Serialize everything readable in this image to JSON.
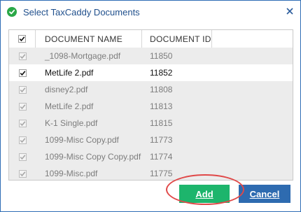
{
  "window": {
    "title": "Select TaxCaddy Documents",
    "close_glyph": "×",
    "icon": "taxcaddy-check-icon"
  },
  "table": {
    "columns": [
      "DOCUMENT NAME",
      "DOCUMENT ID"
    ],
    "header_checked": true,
    "rows": [
      {
        "name": "_1098-Mortgage.pdf",
        "id": "11850",
        "checked": true,
        "disabled": true
      },
      {
        "name": "MetLife 2.pdf",
        "id": "11852",
        "checked": true,
        "disabled": false
      },
      {
        "name": "disney2.pdf",
        "id": "11808",
        "checked": true,
        "disabled": true
      },
      {
        "name": "MetLife 2.pdf",
        "id": "11813",
        "checked": true,
        "disabled": true
      },
      {
        "name": "K-1 Single.pdf",
        "id": "11815",
        "checked": true,
        "disabled": true
      },
      {
        "name": "1099-Misc Copy.pdf",
        "id": "11773",
        "checked": true,
        "disabled": true
      },
      {
        "name": "1099-Misc Copy Copy.pdf",
        "id": "11774",
        "checked": true,
        "disabled": true
      },
      {
        "name": "1099-Misc.pdf",
        "id": "11775",
        "checked": true,
        "disabled": true
      }
    ]
  },
  "buttons": {
    "add_label": "Add",
    "cancel_label": "Cancel"
  },
  "colors": {
    "title": "#1f4f8c",
    "border": "#2f6db5",
    "add": "#1db56c",
    "cancel": "#2e6bb0",
    "highlight": "#e04848"
  }
}
